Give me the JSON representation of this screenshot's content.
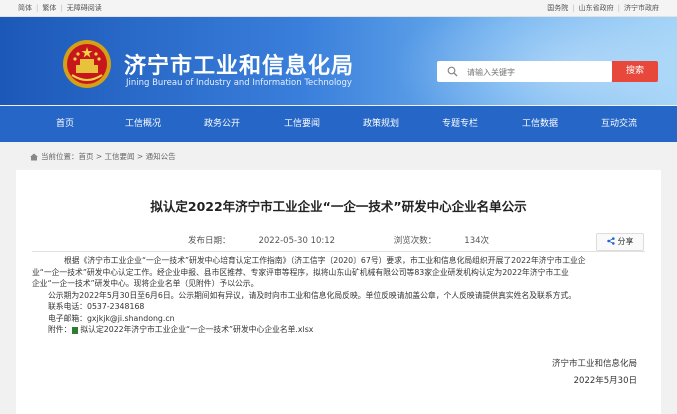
{
  "topbar": {
    "simplified": "简体",
    "traditional": "繁体",
    "accessible": "无障碍阅读",
    "state_council": "国务院",
    "shandong_gov": "山东省政府",
    "jining_gov": "济宁市政府"
  },
  "header": {
    "title": "济宁市工业和信息化局",
    "subtitle": "Jining Bureau of Industry and Information Technology",
    "search_placeholder": "请输入关键字",
    "search_button": "搜索"
  },
  "nav": {
    "items": [
      "首页",
      "工信概况",
      "政务公开",
      "工信要闻",
      "政策规划",
      "专题专栏",
      "工信数据",
      "互动交流"
    ]
  },
  "breadcrumb": {
    "label": "当前位置：",
    "path": "首页 > 工信要闻 > 通知公告"
  },
  "article": {
    "title": "拟认定2022年济宁市工业企业“一企一技术”研发中心企业名单公示",
    "publish_label": "发布日期：",
    "publish_date": "2022-05-30 10:12",
    "views_label": "浏览次数：",
    "views": "134次",
    "share_label": "分享",
    "para1_line1": "根据《济宁市工业企业“一企一技术”研发中心培育认定工作指南》（济工信字〔2020〕67号）要求，市工业和信息化局组织开展了2022年济宁市工业企",
    "para1_line2": "业“一企一技术”研发中心认定工作。经企业申报、县市区推荐、专家评审等程序，拟将山东山矿机械有限公司等83家企业研发机构认定为2022年济宁市工业",
    "para1_line3": "企业“一企一技术”研发中心。现将企业名单（见附件）予以公示。",
    "para2": "公示期为2022年5月30日至6月6日。公示期间如有异议，请及时向市工业和信息化局反映。单位反映请加盖公章，个人反映请提供真实姓名及联系方式。",
    "phone_line": "联系电话：0537-2348168",
    "email_line": "电子邮箱：gxjkjk@ji.shandong.cn",
    "attachment_label": "附件：",
    "attachment_file": "拟认定2022年济宁市工业企业“一企一技术”研发中心企业名单.xlsx",
    "sign_org": "济宁市工业和信息化局",
    "sign_date": "2022年5月30日"
  },
  "colors": {
    "nav_bg": "#2566c6",
    "search_button": "#e8483b",
    "banner_start": "#1c58b8"
  }
}
